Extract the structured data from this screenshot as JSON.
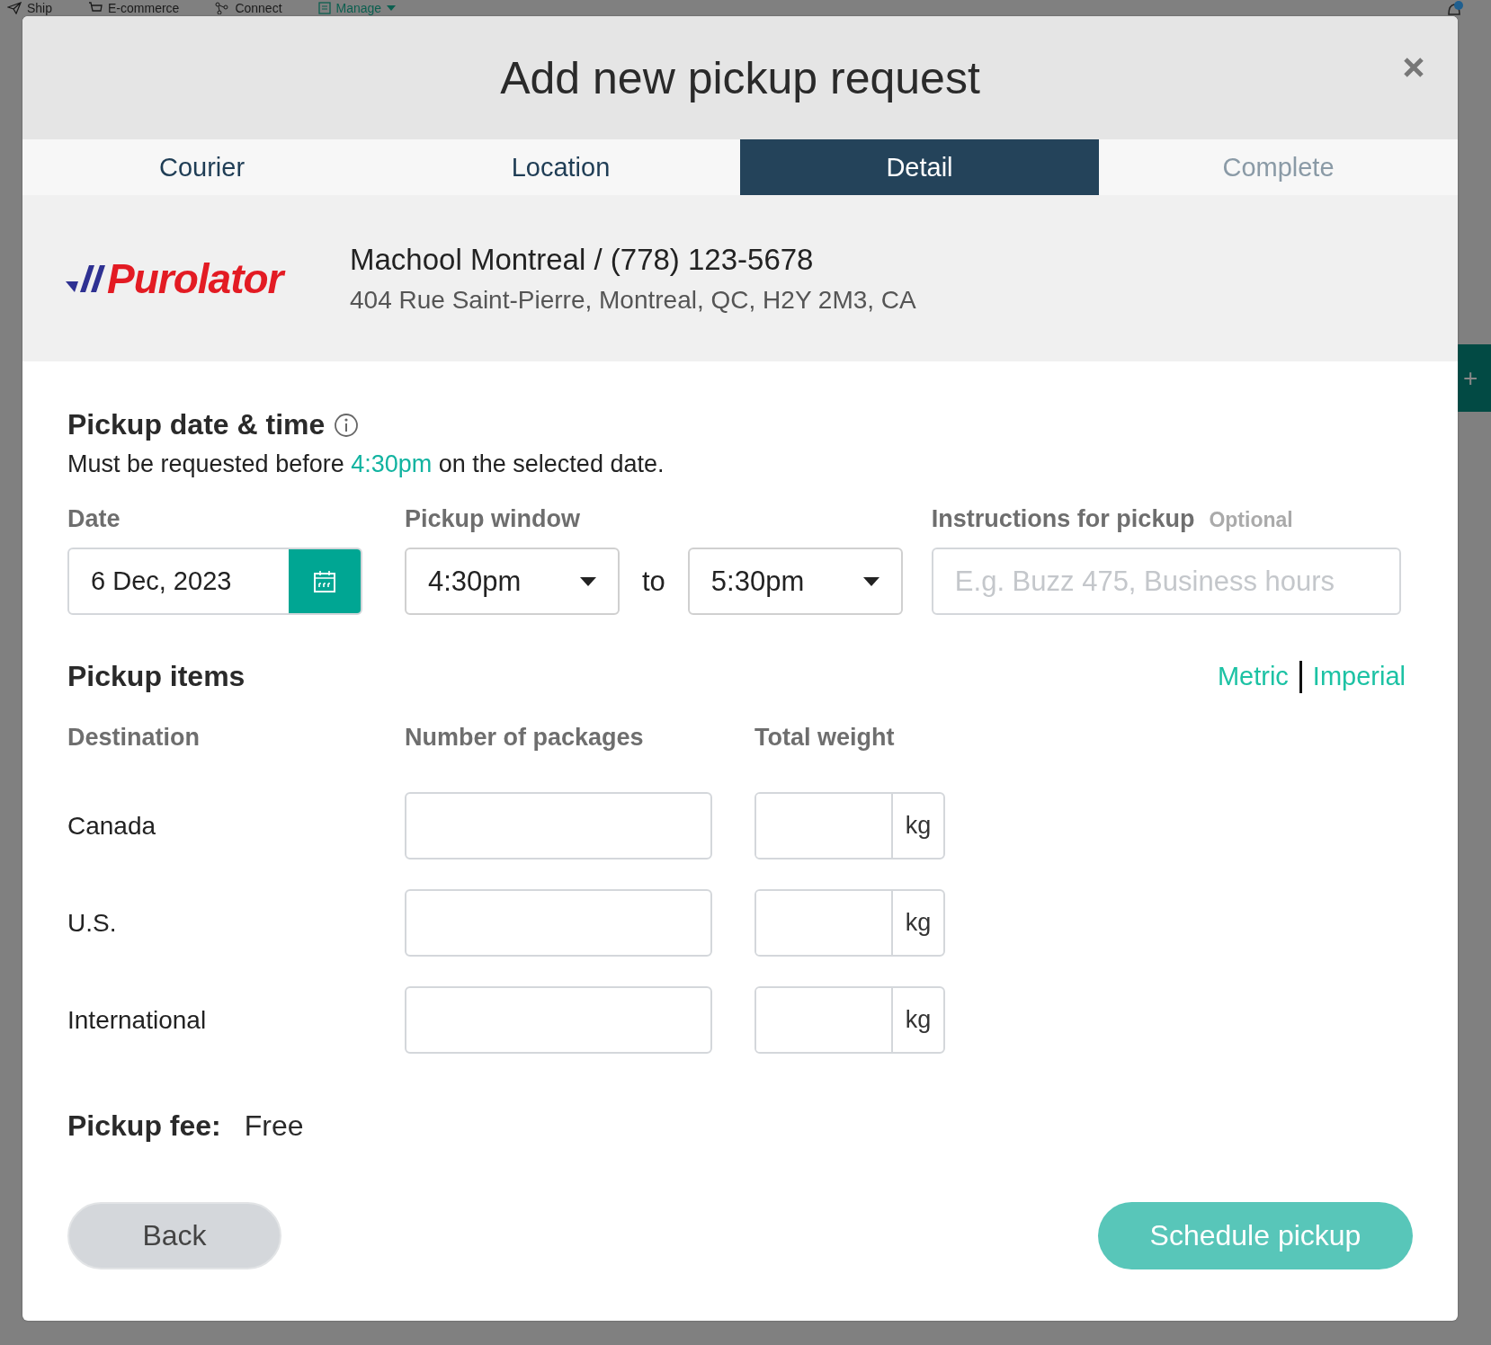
{
  "background": {
    "nav": [
      {
        "label": "Ship",
        "kind": "plane",
        "selected": false
      },
      {
        "label": "E-commerce",
        "kind": "cart",
        "selected": false
      },
      {
        "label": "Connect",
        "kind": "network",
        "selected": false
      },
      {
        "label": "Manage",
        "kind": "document",
        "selected": true
      }
    ],
    "side_button": "+"
  },
  "modal": {
    "title": "Add new pickup request",
    "tabs": [
      {
        "label": "Courier",
        "selected": false,
        "disabled": false
      },
      {
        "label": "Location",
        "selected": false,
        "disabled": false
      },
      {
        "label": "Detail",
        "selected": true,
        "disabled": false
      },
      {
        "label": "Complete",
        "selected": false,
        "disabled": true
      }
    ],
    "courier": {
      "logo": "Purolator",
      "location": "Machool Montreal / (778) 123-5678",
      "address": "404 Rue Saint-Pierre, Montreal, QC, H2Y 2M3, CA"
    },
    "schedule": {
      "title": "Pickup date & time",
      "note": {
        "before": "Must be requested before ",
        "deadline": "4:30pm",
        "after": " on the selected date."
      },
      "date": {
        "label": "Date",
        "value": "6 Dec, 2023"
      },
      "window": {
        "label": "Pickup window",
        "from": "4:30pm",
        "separator": "to",
        "to": "5:30pm"
      },
      "instructions": {
        "label": "Instructions for pickup",
        "hint": "Optional",
        "placeholder": "E.g. Buzz 475, Business hours"
      }
    },
    "items": {
      "title": "Pickup items",
      "units": [
        "Metric",
        "Imperial"
      ],
      "columns": [
        "Destination",
        "Number of packages",
        "Total weight"
      ],
      "rows": [
        {
          "destination": "Canada",
          "unit": "kg"
        },
        {
          "destination": "U.S.",
          "unit": "kg"
        },
        {
          "destination": "International",
          "unit": "kg"
        }
      ]
    },
    "fee": {
      "label": "Pickup fee:",
      "value": "Free"
    },
    "buttons": {
      "back": "Back",
      "submit": "Schedule pickup"
    }
  }
}
